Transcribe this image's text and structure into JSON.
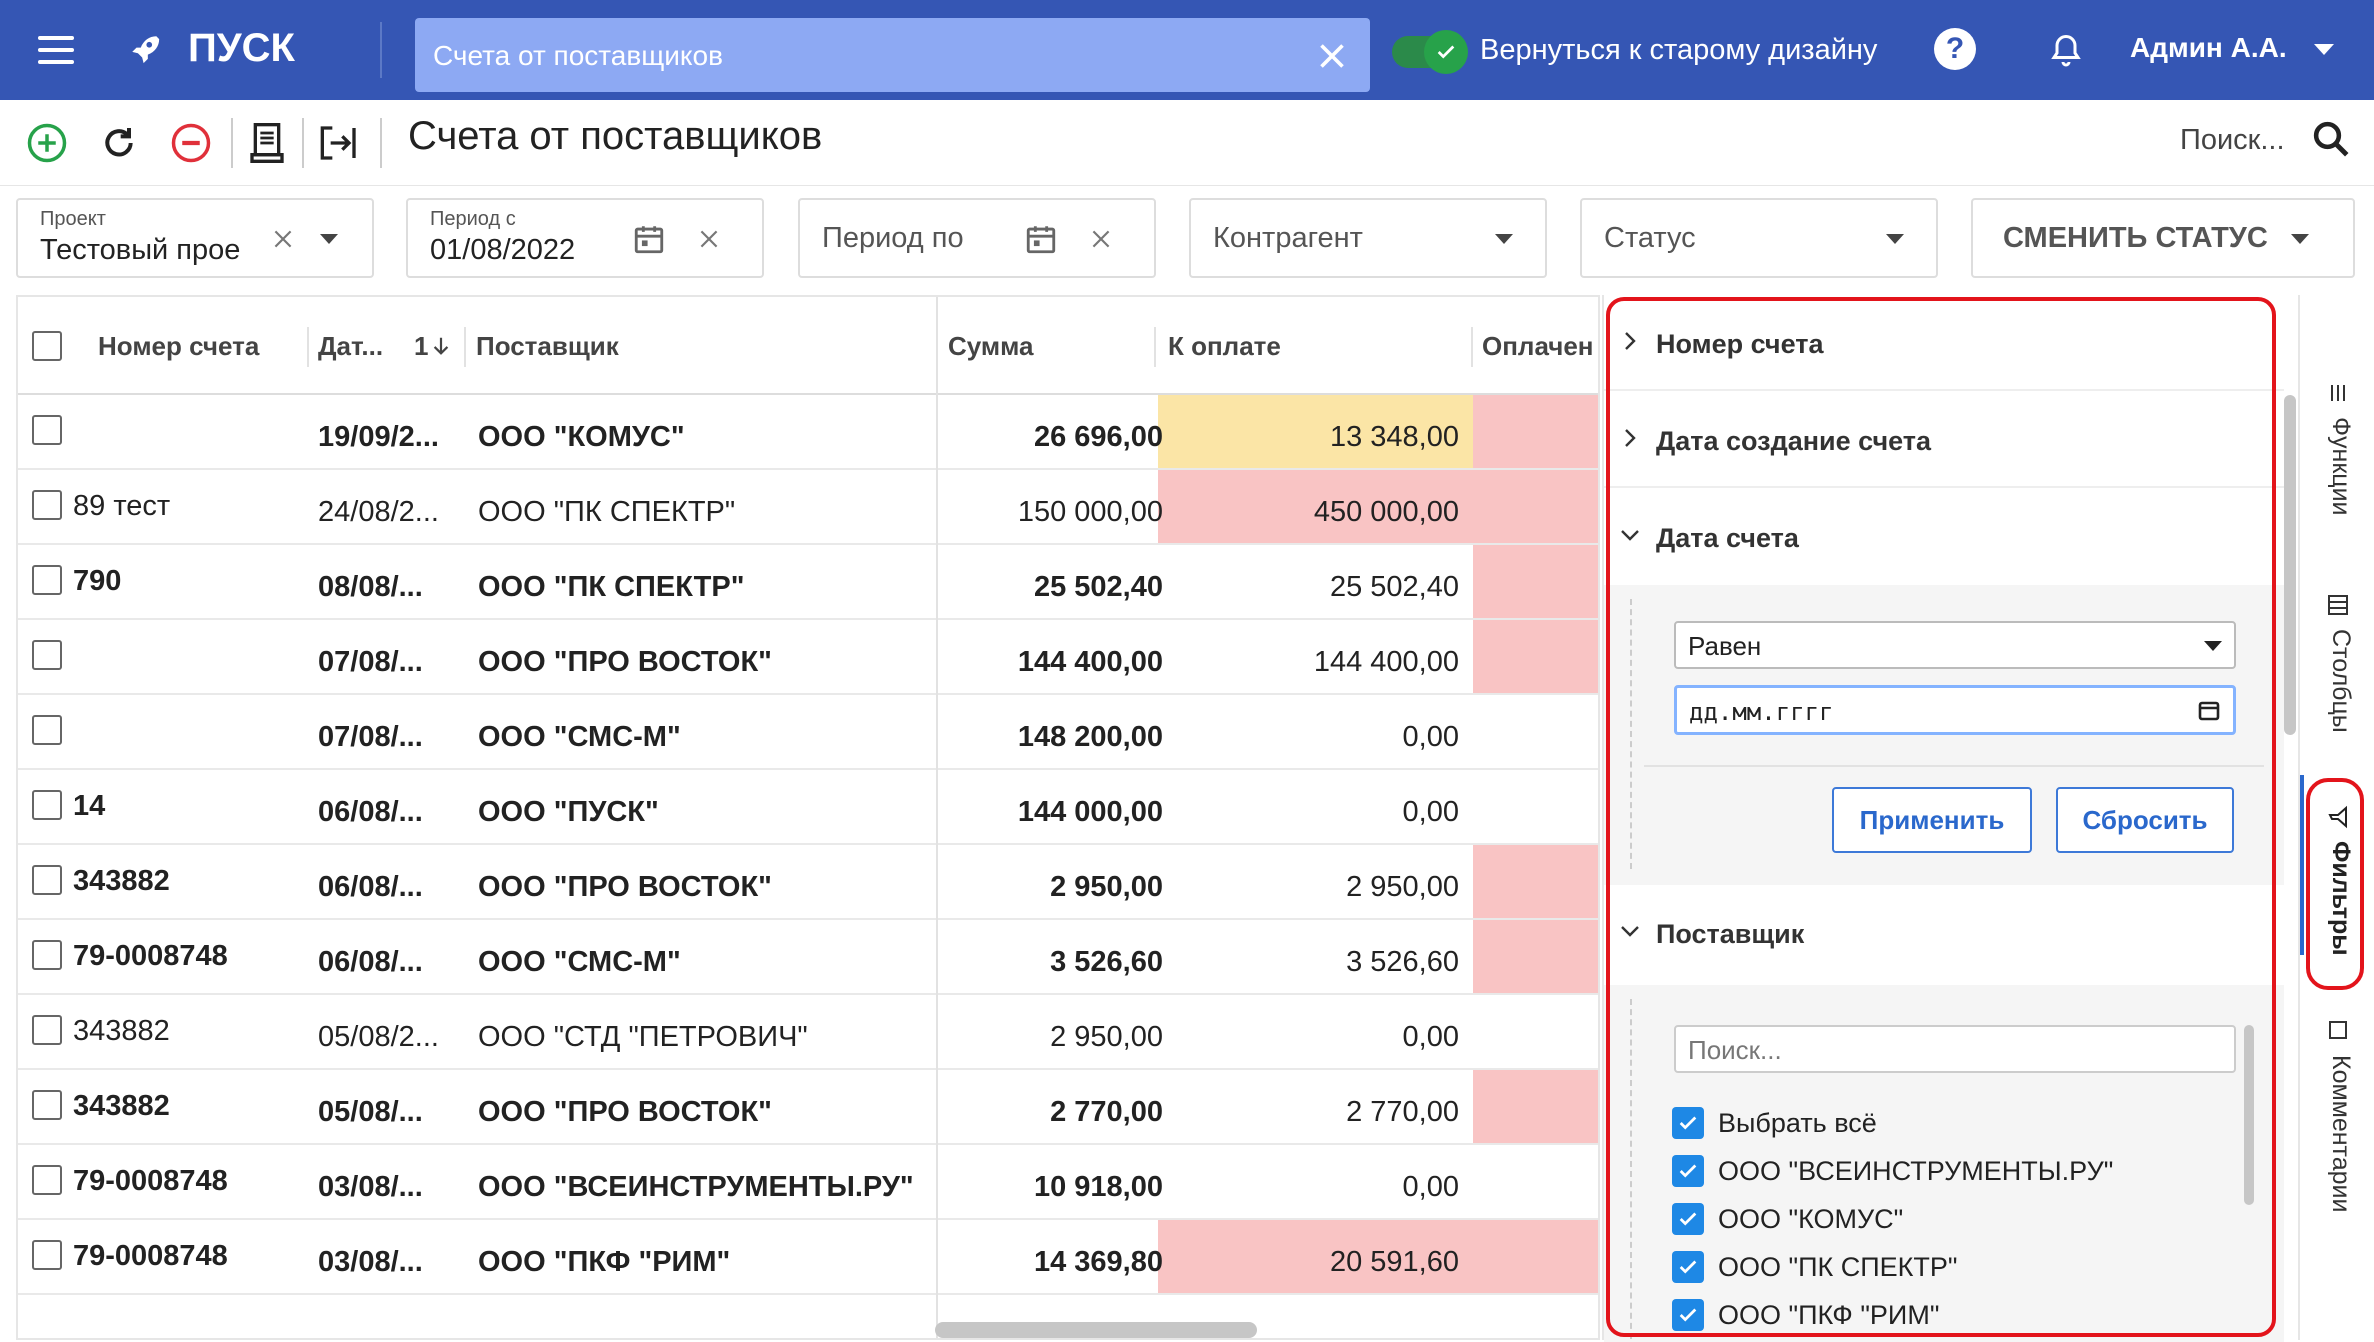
{
  "app": {
    "brand": "ПУСК",
    "tab_label": "Счета от поставщиков",
    "old_design_label": "Вернуться к старому дизайну",
    "help_symbol": "?",
    "user_name": "Админ А.А."
  },
  "toolbar": {
    "title": "Счета от поставщиков",
    "search_placeholder": "Поиск..."
  },
  "filters": {
    "project": {
      "label": "Проект",
      "value": "Тестовый прое"
    },
    "period_from": {
      "label": "Период с",
      "value": "01/08/2022"
    },
    "period_to": {
      "placeholder": "Период по"
    },
    "counterparty": {
      "placeholder": "Контрагент"
    },
    "status": {
      "placeholder": "Статус"
    },
    "change_status": {
      "label": "СМЕНИТЬ СТАТУС"
    }
  },
  "table": {
    "columns": {
      "number": "Номер счета",
      "date": "Дат...",
      "sort_indicator": "1",
      "supplier": "Поставщик",
      "sum": "Сумма",
      "to_pay": "К оплате",
      "paid": "Оплачен"
    },
    "rows": [
      {
        "number": "",
        "date": "19/09/2...",
        "supplier": "ООО \"КОМУС\"",
        "sum": "26 696,00",
        "to_pay": "13 348,00",
        "bold": true,
        "pay_color": "#fbe5a6",
        "paid_color": "#f9c4c4"
      },
      {
        "number": "89 тест",
        "date": "24/08/2...",
        "supplier": "ООО \"ПК СПЕКТР\"",
        "sum": "150 000,00",
        "to_pay": "450 000,00",
        "bold": false,
        "pay_color": "#f9c4c4",
        "paid_color": "#f9c4c4"
      },
      {
        "number": "790",
        "date": "08/08/...",
        "supplier": "ООО \"ПК СПЕКТР\"",
        "sum": "25 502,40",
        "to_pay": "25 502,40",
        "bold": true,
        "pay_color": "#ffffff",
        "paid_color": "#f9c4c4"
      },
      {
        "number": "",
        "date": "07/08/...",
        "supplier": "ООО \"ПРО ВОСТОК\"",
        "sum": "144 400,00",
        "to_pay": "144 400,00",
        "bold": true,
        "pay_color": "#ffffff",
        "paid_color": "#f9c4c4"
      },
      {
        "number": "",
        "date": "07/08/...",
        "supplier": "ООО \"СМС-М\"",
        "sum": "148 200,00",
        "to_pay": "0,00",
        "bold": true,
        "pay_color": "#ffffff",
        "paid_color": "#ffffff"
      },
      {
        "number": "14",
        "date": "06/08/...",
        "supplier": "ООО \"ПУСК\"",
        "sum": "144 000,00",
        "to_pay": "0,00",
        "bold": true,
        "pay_color": "#ffffff",
        "paid_color": "#ffffff"
      },
      {
        "number": "343882",
        "date": "06/08/...",
        "supplier": "ООО \"ПРО ВОСТОК\"",
        "sum": "2 950,00",
        "to_pay": "2 950,00",
        "bold": true,
        "pay_color": "#ffffff",
        "paid_color": "#f9c4c4"
      },
      {
        "number": "79-0008748",
        "date": "06/08/...",
        "supplier": "ООО \"СМС-М\"",
        "sum": "3 526,60",
        "to_pay": "3 526,60",
        "bold": true,
        "pay_color": "#ffffff",
        "paid_color": "#f9c4c4"
      },
      {
        "number": "343882",
        "date": "05/08/2...",
        "supplier": "ООО \"СТД \"ПЕТРОВИЧ\"",
        "sum": "2 950,00",
        "to_pay": "0,00",
        "bold": false,
        "pay_color": "#ffffff",
        "paid_color": "#ffffff"
      },
      {
        "number": "343882",
        "date": "05/08/...",
        "supplier": "ООО \"ПРО ВОСТОК\"",
        "sum": "2 770,00",
        "to_pay": "2 770,00",
        "bold": true,
        "pay_color": "#ffffff",
        "paid_color": "#f9c4c4"
      },
      {
        "number": "79-0008748",
        "date": "03/08/...",
        "supplier": "ООО \"ВСЕИНСТРУМЕНТЫ.РУ\"",
        "sum": "10 918,00",
        "to_pay": "0,00",
        "bold": true,
        "pay_color": "#ffffff",
        "paid_color": "#ffffff"
      },
      {
        "number": "79-0008748",
        "date": "03/08/...",
        "supplier": "ООО \"ПКФ \"РИМ\"",
        "sum": "14 369,80",
        "to_pay": "20 591,60",
        "bold": true,
        "pay_color": "#f9c4c4",
        "paid_color": "#f9c4c4"
      }
    ]
  },
  "filter_panel": {
    "sections": {
      "invoice_number": "Номер счета",
      "created_date": "Дата создание счета",
      "invoice_date": "Дата счета",
      "supplier": "Поставщик"
    },
    "operator": "Равен",
    "date_placeholder": "дд.мм.гггг",
    "apply": "Применить",
    "reset": "Сбросить",
    "supplier_search_placeholder": "Поиск...",
    "options": [
      "Выбрать всё",
      "ООО \"ВСЕИНСТРУМЕНТЫ.РУ\"",
      "ООО \"КОМУС\"",
      "ООО \"ПК СПЕКТР\"",
      "ООО \"ПКФ \"РИМ\""
    ]
  },
  "side_rail": {
    "functions": "Функции",
    "columns": "Столбцы",
    "filters": "Фильтры",
    "comments": "Комментарии"
  },
  "colors": {
    "header": "#3556b4",
    "tab": "#8da9f3",
    "accent": "#2a68cc",
    "highlight_red": "#e3141b",
    "add": "#27a24a",
    "remove": "#e0303a"
  }
}
